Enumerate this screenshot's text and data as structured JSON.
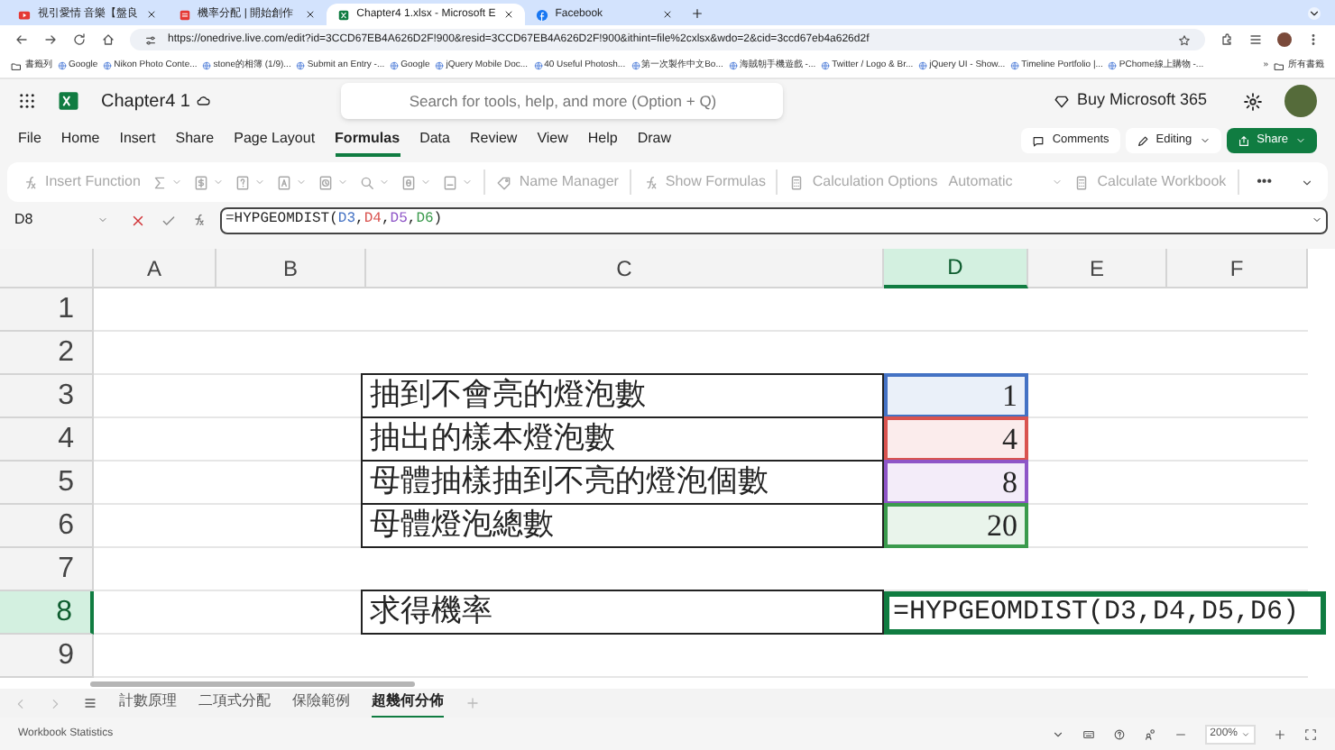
{
  "browser": {
    "tabs": [
      {
        "title": "視引愛情 音樂【盤良",
        "selected": false,
        "kind": "video"
      },
      {
        "title": "機率分配 | 開始創作",
        "selected": false,
        "kind": "doc"
      },
      {
        "title": "Chapter4 1.xlsx - Microsoft E",
        "selected": true,
        "kind": "excel"
      },
      {
        "title": "Facebook",
        "selected": false,
        "kind": "facebook"
      }
    ],
    "url": "https://onedrive.live.com/edit?id=3CCD67EB4A626D2F!900&resid=3CCD67EB4A626D2F!900&ithint=file%2cxlsx&wdo=2&cid=3ccd67eb4a626d2f",
    "bookmarks": [
      "Google",
      "Nikon Photo Conte...",
      "stone的相簿 (1/9)...",
      "Submit an Entry -...",
      "Google",
      "jQuery Mobile Doc...",
      "40 Useful Photosh...",
      "第一次製作中文Bo...",
      "海賊朝手機遊戲 -...",
      "Twitter / Logo & Br...",
      "jQuery UI - Show...",
      "Timeline Portfolio |...",
      "PChome線上購物 -..."
    ],
    "bookmarks_folder": "書籤列",
    "more_bookmarks": "»",
    "all_bookmarks": "所有書籤"
  },
  "app": {
    "title": "Chapter4 1",
    "search_placeholder": "Search for tools, help, and more (Option + Q)",
    "buy": "Buy Microsoft 365"
  },
  "menu": [
    {
      "label": "File",
      "selected": false
    },
    {
      "label": "Home",
      "selected": false
    },
    {
      "label": "Insert",
      "selected": false
    },
    {
      "label": "Share",
      "selected": false
    },
    {
      "label": "Page Layout",
      "selected": false
    },
    {
      "label": "Formulas",
      "selected": true
    },
    {
      "label": "Data",
      "selected": false
    },
    {
      "label": "Review",
      "selected": false
    },
    {
      "label": "View",
      "selected": false
    },
    {
      "label": "Help",
      "selected": false
    },
    {
      "label": "Draw",
      "selected": false
    }
  ],
  "actions": {
    "comments": "Comments",
    "editing": "Editing",
    "share": "Share"
  },
  "ribbon": [
    {
      "kind": "fx",
      "label": "Insert Function",
      "disabled": true
    },
    {
      "kind": "icondrop",
      "disabled": true
    },
    {
      "kind": "icondrop",
      "disabled": true
    },
    {
      "kind": "icondrop",
      "disabled": true
    },
    {
      "kind": "icondrop",
      "disabled": true
    },
    {
      "kind": "icondrop",
      "disabled": true
    },
    {
      "kind": "icondrop",
      "disabled": true
    },
    {
      "kind": "icondrop",
      "disabled": true
    },
    {
      "kind": "icondrop",
      "disabled": true
    },
    {
      "kind": "sep"
    },
    {
      "kind": "tag",
      "label": "Name Manager",
      "disabled": true
    },
    {
      "kind": "sep"
    },
    {
      "kind": "fx",
      "label": "Show Formulas",
      "disabled": true
    },
    {
      "kind": "sep"
    },
    {
      "kind": "calc",
      "label": "Calculation Options",
      "disabled": true
    },
    {
      "kind": "select",
      "label": "Automatic",
      "disabled": true
    },
    {
      "kind": "calc",
      "label": "Calculate Workbook",
      "disabled": true
    },
    {
      "kind": "sep"
    },
    {
      "kind": "dots",
      "label": "•••",
      "disabled": false
    }
  ],
  "formula_bar": {
    "name_box": "D8",
    "formula": [
      {
        "text": "=HYPGEOMDIST("
      },
      {
        "text": "D3",
        "color": "#4472c4"
      },
      {
        "text": ","
      },
      {
        "text": "D4",
        "color": "#d9534f"
      },
      {
        "text": ","
      },
      {
        "text": "D5",
        "color": "#8e55c7"
      },
      {
        "text": ","
      },
      {
        "text": "D6",
        "color": "#3a9a4c"
      },
      {
        "text": ")"
      }
    ]
  },
  "sheet": {
    "columns": [
      {
        "label": "A",
        "selected": false
      },
      {
        "label": "B",
        "selected": false
      },
      {
        "label": "C",
        "selected": false
      },
      {
        "label": "D",
        "selected": true
      },
      {
        "label": "E",
        "selected": false
      },
      {
        "label": "F",
        "selected": false
      }
    ],
    "rows": [
      {
        "label": "1",
        "selected": false,
        "cells": []
      },
      {
        "label": "2",
        "selected": false,
        "cells": []
      },
      {
        "label": "3",
        "selected": false,
        "cells": [
          {
            "kind": "label",
            "text": "抽到不會亮的燈泡數"
          },
          {
            "kind": "value",
            "text": "1",
            "color": "#4472c4"
          }
        ]
      },
      {
        "label": "4",
        "selected": false,
        "cells": [
          {
            "kind": "label",
            "text": "抽出的樣本燈泡數"
          },
          {
            "kind": "value",
            "text": "4",
            "color": "#d9534f"
          }
        ]
      },
      {
        "label": "5",
        "selected": false,
        "cells": [
          {
            "kind": "label",
            "text": "母體抽樣抽到不亮的燈泡個數"
          },
          {
            "kind": "value",
            "text": "8",
            "color": "#8e55c7"
          }
        ]
      },
      {
        "label": "6",
        "selected": false,
        "cells": [
          {
            "kind": "label",
            "text": "母體燈泡總數"
          },
          {
            "kind": "value",
            "text": "20",
            "color": "#3a9a4c"
          }
        ]
      },
      {
        "label": "7",
        "selected": false,
        "cells": []
      },
      {
        "label": "8",
        "selected": true,
        "cells": [
          {
            "kind": "label",
            "text": "求得機率"
          },
          {
            "kind": "formula",
            "text": "=HYPGEOMDIST(D3,D4,D5,D6)",
            "selected": true
          }
        ]
      },
      {
        "label": "9",
        "selected": false,
        "cells": []
      }
    ]
  },
  "sheet_tabs": [
    {
      "label": "計數原理",
      "selected": false
    },
    {
      "label": "二項式分配",
      "selected": false
    },
    {
      "label": "保險範例",
      "selected": false
    },
    {
      "label": "超幾何分佈",
      "selected": true
    }
  ],
  "status_bar": {
    "left": "Workbook Statistics",
    "zoom": "200%"
  }
}
